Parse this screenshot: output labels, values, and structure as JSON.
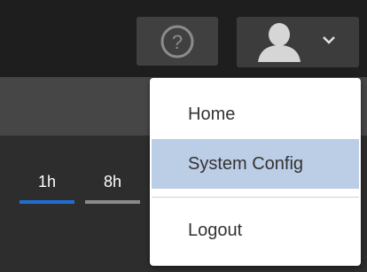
{
  "header": {
    "help_icon": "question-circle-icon",
    "user_icon": "user-silhouette-icon",
    "chevron_icon": "chevron-down-icon"
  },
  "time_range": {
    "tabs": [
      {
        "label": "1h",
        "active": true,
        "underline_color": "#1f6fd1"
      },
      {
        "label": "8h",
        "active": false,
        "underline_color": "#8a8a8a"
      }
    ]
  },
  "user_menu": {
    "items": [
      {
        "label": "Home",
        "highlighted": false
      },
      {
        "label": "System Config",
        "highlighted": true
      },
      {
        "label": "Logout",
        "highlighted": false
      }
    ],
    "highlight_color": "#bccde6"
  },
  "colors": {
    "topbar": "#1e1e1e",
    "subbar": "#464646",
    "accent_blue": "#1f6fd1"
  }
}
